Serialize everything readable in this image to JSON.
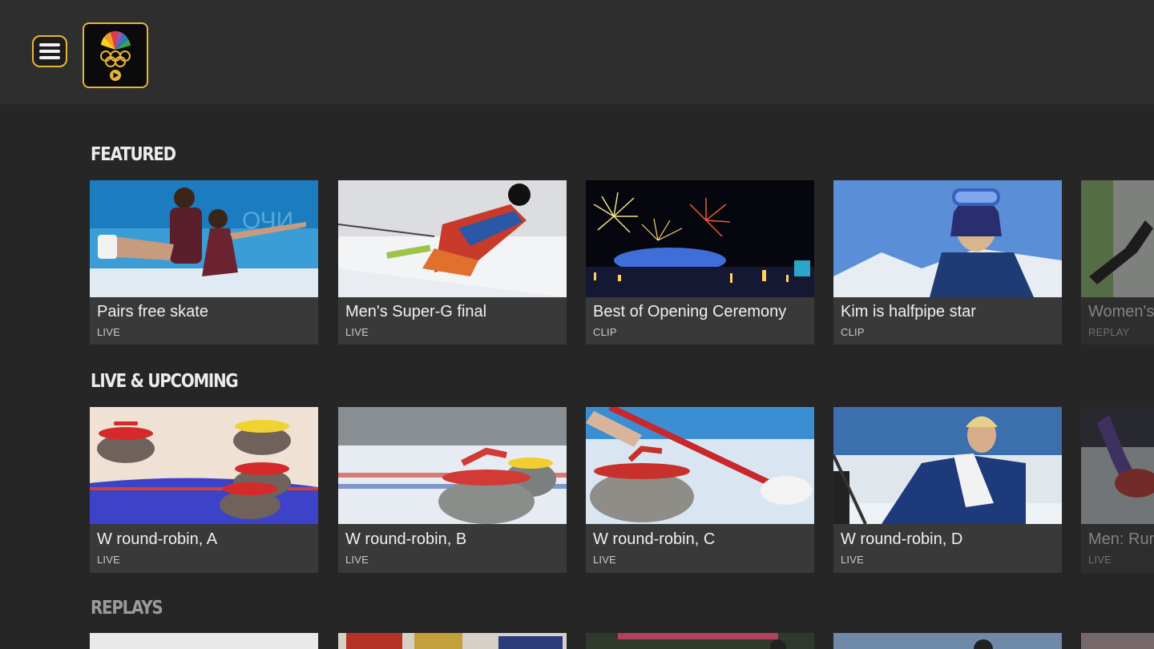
{
  "header": {
    "menu_icon": "hamburger-menu-icon",
    "logo_icon": "nbc-olympics-peacock-icon",
    "accent_color": "#e7b53a"
  },
  "sections": [
    {
      "title": "FEATURED",
      "cards": [
        {
          "title": "Pairs free skate",
          "tag": "LIVE"
        },
        {
          "title": "Men's Super-G final",
          "tag": "LIVE"
        },
        {
          "title": "Best of Opening Ceremony",
          "tag": "CLIP"
        },
        {
          "title": "Kim is halfpipe star",
          "tag": "CLIP"
        },
        {
          "title": "Women's",
          "tag": "REPLAY"
        }
      ]
    },
    {
      "title": "LIVE & UPCOMING",
      "cards": [
        {
          "title": "W round-robin, A",
          "tag": "LIVE"
        },
        {
          "title": "W round-robin, B",
          "tag": "LIVE"
        },
        {
          "title": "W round-robin, C",
          "tag": "LIVE"
        },
        {
          "title": "W round-robin, D",
          "tag": "LIVE"
        },
        {
          "title": "Men: Run",
          "tag": "LIVE"
        }
      ]
    },
    {
      "title": "REPLAYS",
      "cards": []
    }
  ]
}
